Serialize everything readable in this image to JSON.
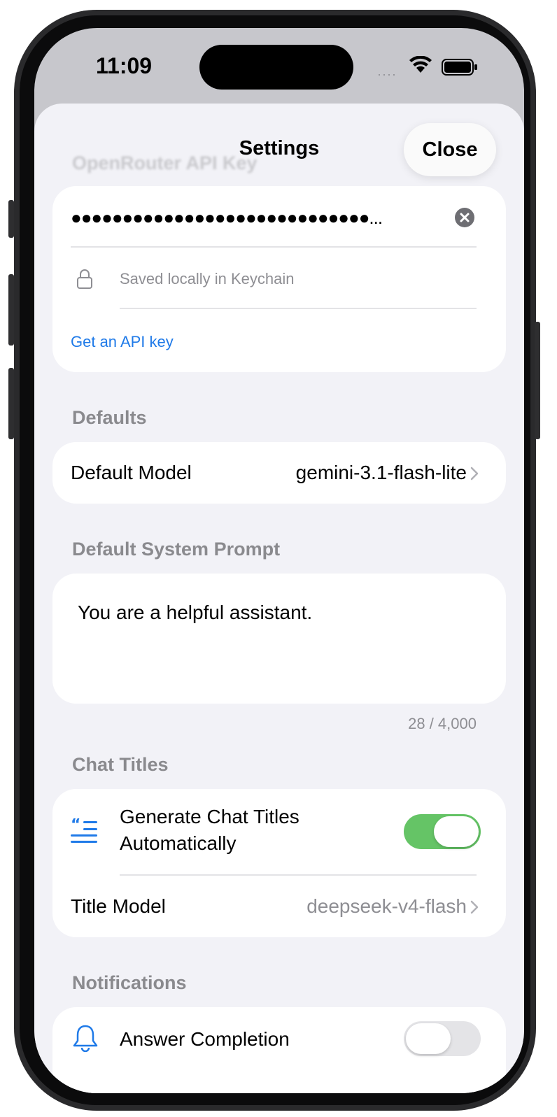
{
  "status_bar": {
    "time": "11:09"
  },
  "nav": {
    "title": "Settings",
    "close_label": "Close"
  },
  "api_key": {
    "header": "OpenRouter API Key",
    "masked_value": "●●●●●●●●●●●●●●●●●●●●●●●●●●●●●...",
    "saved_note": "Saved locally in Keychain",
    "link": "Get an API key"
  },
  "defaults": {
    "header": "Defaults",
    "model_label": "Default Model",
    "model_value": "gemini-3.1-flash-lite"
  },
  "system_prompt": {
    "header": "Default System Prompt",
    "value": "You are a helpful assistant.",
    "counter": "28 / 4,000"
  },
  "chat_titles": {
    "header": "Chat Titles",
    "toggle_label_line1": "Generate Chat Titles",
    "toggle_label_line2": "Automatically",
    "toggle_on": true,
    "title_model_label": "Title Model",
    "title_model_value": "deepseek-v4-flash"
  },
  "notifications": {
    "header": "Notifications",
    "answer_completion_label": "Answer Completion",
    "toggle_on": false
  },
  "colors": {
    "accent": "#1f7ae8",
    "toggle_on": "#65c466",
    "toggle_off": "#e4e4e7",
    "background": "#f2f2f7"
  },
  "icons": {
    "lock": "lock-icon",
    "quote_list": "quote-list-icon",
    "bell": "bell-icon",
    "clear": "clear-icon",
    "chevron": "chevron-right-icon"
  }
}
